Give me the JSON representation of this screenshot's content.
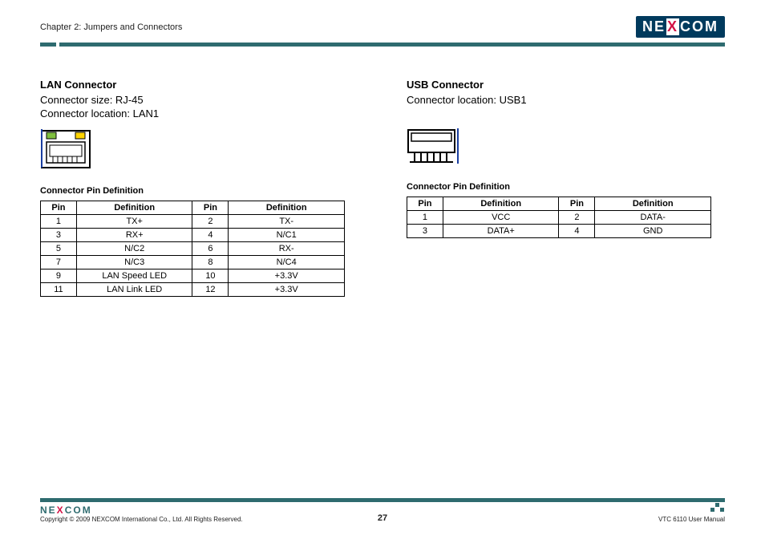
{
  "header": {
    "chapter": "Chapter 2: Jumpers and Connectors",
    "logo_left": "NE",
    "logo_x": "X",
    "logo_right": "COM"
  },
  "left": {
    "title": "LAN Connector",
    "meta1": "Connector size: RJ-45",
    "meta2": "Connector location: LAN1",
    "table_title": "Connector Pin Definition",
    "headers": {
      "pin": "Pin",
      "def": "Definition"
    },
    "rows": [
      {
        "p1": "1",
        "d1": "TX+",
        "p2": "2",
        "d2": "TX-"
      },
      {
        "p1": "3",
        "d1": "RX+",
        "p2": "4",
        "d2": "N/C1"
      },
      {
        "p1": "5",
        "d1": "N/C2",
        "p2": "6",
        "d2": "RX-"
      },
      {
        "p1": "7",
        "d1": "N/C3",
        "p2": "8",
        "d2": "N/C4"
      },
      {
        "p1": "9",
        "d1": "LAN Speed LED",
        "p2": "10",
        "d2": "+3.3V"
      },
      {
        "p1": "11",
        "d1": "LAN Link LED",
        "p2": "12",
        "d2": "+3.3V"
      }
    ]
  },
  "right": {
    "title": "USB Connector",
    "meta1": "Connector location: USB1",
    "table_title": "Connector Pin Definition",
    "headers": {
      "pin": "Pin",
      "def": "Definition"
    },
    "rows": [
      {
        "p1": "1",
        "d1": "VCC",
        "p2": "2",
        "d2": "DATA-"
      },
      {
        "p1": "3",
        "d1": "DATA+",
        "p2": "4",
        "d2": "GND"
      }
    ]
  },
  "footer": {
    "logo_left": "NE",
    "logo_x": "X",
    "logo_right": "COM",
    "copyright": "Copyright © 2009 NEXCOM International Co., Ltd. All Rights Reserved.",
    "page": "27",
    "doc": "VTC 6110 User Manual"
  }
}
